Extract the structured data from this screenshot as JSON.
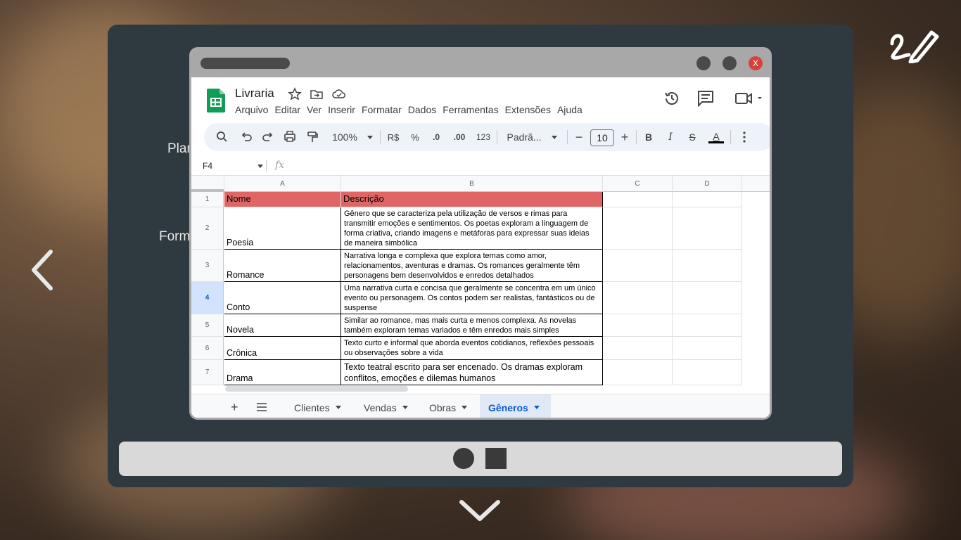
{
  "background": {
    "side_labels": [
      "Plar",
      "Form"
    ]
  },
  "spreadsheet": {
    "title": "Livraria",
    "close_label": "X",
    "menu": [
      "Arquivo",
      "Editar",
      "Ver",
      "Inserir",
      "Formatar",
      "Dados",
      "Ferramentas",
      "Extensões",
      "Ajuda"
    ],
    "toolbar": {
      "zoom": "100%",
      "currency": "R$",
      "percent": "%",
      "dec_less": ".0",
      "dec_more": ".00",
      "number_format": "123",
      "font": "Padrã...",
      "font_size": "10",
      "bold": "B",
      "italic": "I",
      "strike": "S",
      "text_color": "A"
    },
    "name_box": "F4",
    "fx_label": "fx",
    "columns": [
      "A",
      "B",
      "C",
      "D"
    ],
    "header_row": {
      "num": "1",
      "a": "Nome",
      "b": "Descrição"
    },
    "rows": [
      {
        "num": "2",
        "a": "Poesia",
        "b": "Gênero que se caracteriza pela utilização de versos e rimas para transmitir emoções e sentimentos. Os poetas exploram a linguagem de forma criativa, criando imagens e metáforas para expressar suas ideias de maneira simbólica"
      },
      {
        "num": "3",
        "a": "Romance",
        "b": "Narrativa longa e complexa que explora temas como amor, relacionamentos, aventuras e dramas. Os romances geralmente têm personagens bem desenvolvidos e enredos detalhados"
      },
      {
        "num": "4",
        "a": "Conto",
        "b": "Uma narrativa curta e concisa que geralmente se concentra em um único evento ou personagem. Os contos podem ser realistas, fantásticos ou de suspense"
      },
      {
        "num": "5",
        "a": "Novela",
        "b": "Similar ao romance, mas mais curta e menos complexa. As novelas também exploram temas variados e têm enredos mais simples"
      },
      {
        "num": "6",
        "a": "Crônica",
        "b": "Texto curto e informal que aborda eventos cotidianos, reflexões pessoais ou observações sobre a vida"
      },
      {
        "num": "7",
        "a": "Drama",
        "b": "Texto teatral escrito para ser encenado. Os dramas exploram conflitos, emoções e dilemas humanos"
      }
    ],
    "tabs": [
      "Clientes",
      "Vendas",
      "Obras",
      "Gêneros"
    ],
    "active_tab": "Gêneros",
    "colors": {
      "header_fill": "#e06666",
      "accent": "#0b57d0",
      "sheets_green": "#0f9d58"
    }
  }
}
